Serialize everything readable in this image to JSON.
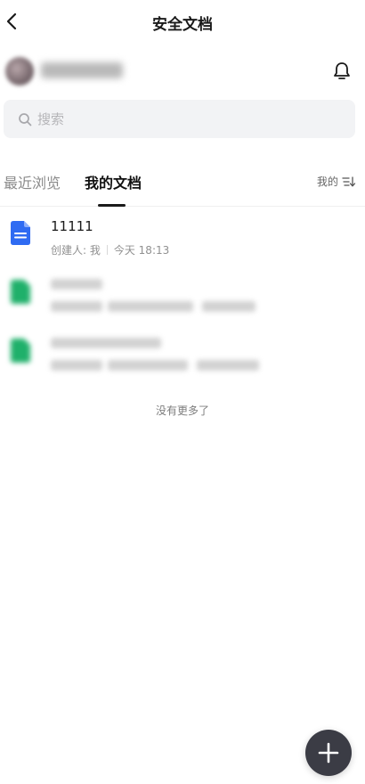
{
  "header": {
    "title": "安全文档",
    "back_icon": "chevron-left-icon",
    "notification_icon": "bell-icon"
  },
  "user": {
    "name": "",
    "avatar_icon": "avatar"
  },
  "search": {
    "placeholder": "搜索",
    "icon": "search-icon"
  },
  "tabs": [
    {
      "label": "最近浏览",
      "active": false
    },
    {
      "label": "我的文档",
      "active": true
    }
  ],
  "sort": {
    "label": "我的",
    "icon": "sort-icon"
  },
  "documents": [
    {
      "title": "11111",
      "creator": "创建人: 我",
      "time": "今天 18:13",
      "icon": "doc-icon",
      "icon_color": "#2f6bf2",
      "blurred": false
    },
    {
      "title": "",
      "creator": "",
      "time": "",
      "icon": "sheet-icon",
      "icon_color": "#1fb06a",
      "blurred": true
    },
    {
      "title": "",
      "creator": "",
      "time": "",
      "icon": "sheet-icon",
      "icon_color": "#1fb06a",
      "blurred": true
    }
  ],
  "footer_text": "没有更多了",
  "fab": {
    "icon": "plus-icon",
    "color": "#3b3c45"
  }
}
